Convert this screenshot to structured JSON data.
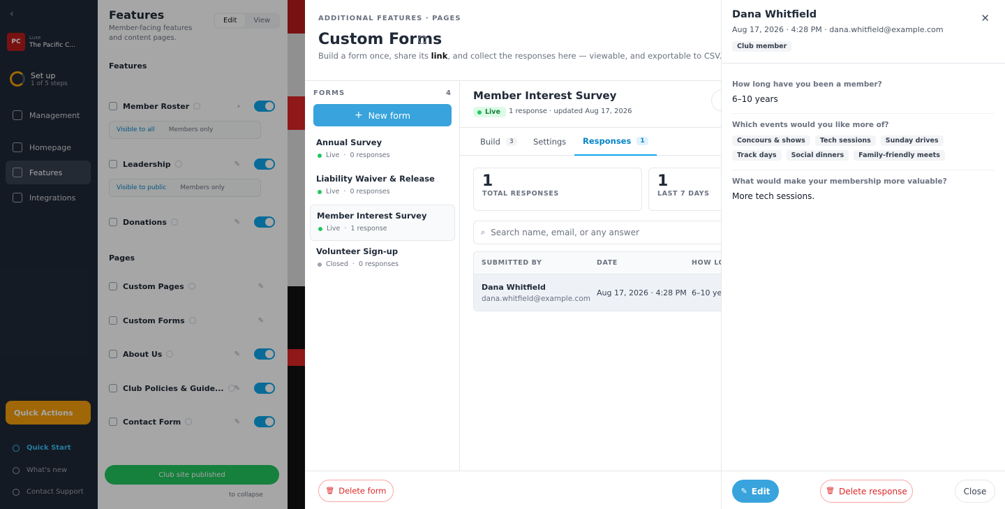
{
  "sidebar": {
    "club_short": "PC",
    "club_line1": "Luxe",
    "club_name": "The Pacific C...",
    "setup_title": "Set up",
    "setup_sub": "1 of 5 steps",
    "nav": [
      "Management",
      "Homepage",
      "Features",
      "Integrations"
    ],
    "quick_actions": "Quick Actions",
    "quick_start": "Quick Start",
    "whats_new": "What's new",
    "contact_support": "Contact Support"
  },
  "features_panel": {
    "title": "Features",
    "subtitle": "Member-facing features and content pages.",
    "edit": "Edit",
    "view": "View",
    "features_heading": "Features",
    "pages_heading": "Pages",
    "member_roster": "Member Roster",
    "leadership": "Leadership",
    "donations": "Donations",
    "visible_to_all": "Visible to all",
    "members_only": "Members only",
    "visible_to_public": "Visible to public",
    "custom_pages": "Custom Pages",
    "custom_forms": "Custom Forms",
    "about_us": "About Us",
    "club_policies": "Club Policies & Guide...",
    "contact_form": "Contact Form",
    "published": "Club site published",
    "collapse": "to collapse"
  },
  "modal": {
    "breadcrumb": "ADDITIONAL FEATURES · PAGES",
    "title": "Custom Forms",
    "desc_before": "Build a form once, share its ",
    "desc_link": "link",
    "desc_after": ", and collect the responses here — viewable, and exportable to CSV.",
    "forms_label": "FORMS",
    "forms_count": "4",
    "new_form": "New form",
    "forms": [
      {
        "name": "Annual Survey",
        "status": "Live",
        "responses": "0 responses"
      },
      {
        "name": "Liability Waiver & Release",
        "status": "Live",
        "responses": "0 responses"
      },
      {
        "name": "Member Interest Survey",
        "status": "Live",
        "responses": "1 response"
      },
      {
        "name": "Volunteer Sign-up",
        "status": "Closed",
        "responses": "0 responses"
      }
    ],
    "delete_form": "Delete form"
  },
  "detail": {
    "title": "Member Interest Survey",
    "status": "Live",
    "meta": "1 response · updated Aug 17, 2026",
    "tabs": {
      "build": "Build",
      "build_count": "3",
      "settings": "Settings",
      "responses": "Responses",
      "responses_count": "1"
    },
    "stats": [
      {
        "value": "1",
        "label": "TOTAL RESPONSES"
      },
      {
        "value": "1",
        "label": "LAST 7 DAYS"
      }
    ],
    "search_placeholder": "Search name, email, or any answer",
    "columns": {
      "submitted_by": "SUBMITTED BY",
      "date": "DATE",
      "how_long": "HOW LO"
    },
    "rows": [
      {
        "name": "Dana Whitfield",
        "email": "dana.whitfield@example.com",
        "date": "Aug 17, 2026 · 4:28 PM",
        "how_long": "6–10 yea"
      }
    ]
  },
  "response_panel": {
    "name": "Dana Whitfield",
    "meta": "Aug 17, 2026 · 4:28 PM · dana.whitfield@example.com",
    "badge": "Club member",
    "q1": "How long have you been a member?",
    "a1": "6–10 years",
    "q2": "Which events would you like more of?",
    "chips": [
      "Concours & shows",
      "Tech sessions",
      "Sunday drives",
      "Track days",
      "Social dinners",
      "Family-friendly meets"
    ],
    "q3": "What would make your membership more valuable?",
    "a3": "More tech sessions.",
    "edit": "Edit",
    "delete_response": "Delete response",
    "close": "Close"
  }
}
